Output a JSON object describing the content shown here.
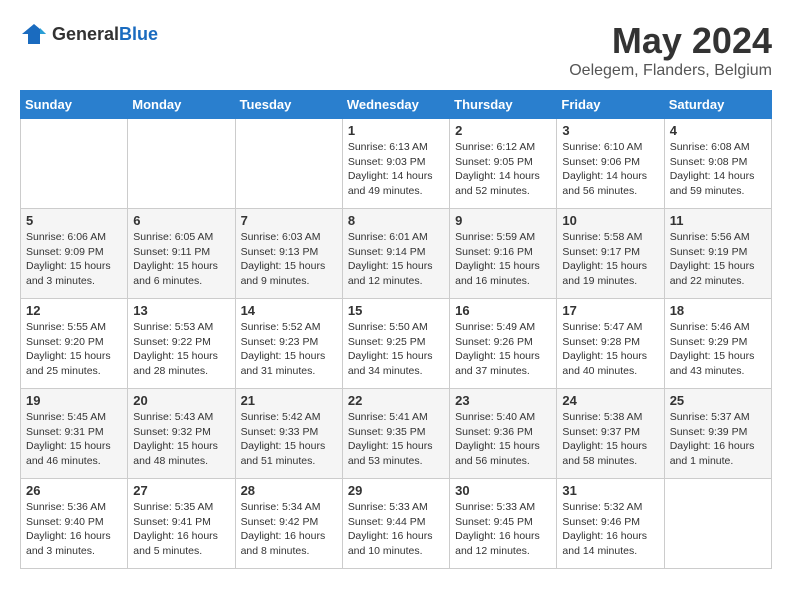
{
  "logo": {
    "text_general": "General",
    "text_blue": "Blue"
  },
  "title": {
    "month": "May 2024",
    "location": "Oelegem, Flanders, Belgium"
  },
  "days_of_week": [
    "Sunday",
    "Monday",
    "Tuesday",
    "Wednesday",
    "Thursday",
    "Friday",
    "Saturday"
  ],
  "weeks": [
    [
      {
        "day": "",
        "sunrise": "",
        "sunset": "",
        "daylight": ""
      },
      {
        "day": "",
        "sunrise": "",
        "sunset": "",
        "daylight": ""
      },
      {
        "day": "",
        "sunrise": "",
        "sunset": "",
        "daylight": ""
      },
      {
        "day": "1",
        "sunrise": "Sunrise: 6:13 AM",
        "sunset": "Sunset: 9:03 PM",
        "daylight": "Daylight: 14 hours and 49 minutes."
      },
      {
        "day": "2",
        "sunrise": "Sunrise: 6:12 AM",
        "sunset": "Sunset: 9:05 PM",
        "daylight": "Daylight: 14 hours and 52 minutes."
      },
      {
        "day": "3",
        "sunrise": "Sunrise: 6:10 AM",
        "sunset": "Sunset: 9:06 PM",
        "daylight": "Daylight: 14 hours and 56 minutes."
      },
      {
        "day": "4",
        "sunrise": "Sunrise: 6:08 AM",
        "sunset": "Sunset: 9:08 PM",
        "daylight": "Daylight: 14 hours and 59 minutes."
      }
    ],
    [
      {
        "day": "5",
        "sunrise": "Sunrise: 6:06 AM",
        "sunset": "Sunset: 9:09 PM",
        "daylight": "Daylight: 15 hours and 3 minutes."
      },
      {
        "day": "6",
        "sunrise": "Sunrise: 6:05 AM",
        "sunset": "Sunset: 9:11 PM",
        "daylight": "Daylight: 15 hours and 6 minutes."
      },
      {
        "day": "7",
        "sunrise": "Sunrise: 6:03 AM",
        "sunset": "Sunset: 9:13 PM",
        "daylight": "Daylight: 15 hours and 9 minutes."
      },
      {
        "day": "8",
        "sunrise": "Sunrise: 6:01 AM",
        "sunset": "Sunset: 9:14 PM",
        "daylight": "Daylight: 15 hours and 12 minutes."
      },
      {
        "day": "9",
        "sunrise": "Sunrise: 5:59 AM",
        "sunset": "Sunset: 9:16 PM",
        "daylight": "Daylight: 15 hours and 16 minutes."
      },
      {
        "day": "10",
        "sunrise": "Sunrise: 5:58 AM",
        "sunset": "Sunset: 9:17 PM",
        "daylight": "Daylight: 15 hours and 19 minutes."
      },
      {
        "day": "11",
        "sunrise": "Sunrise: 5:56 AM",
        "sunset": "Sunset: 9:19 PM",
        "daylight": "Daylight: 15 hours and 22 minutes."
      }
    ],
    [
      {
        "day": "12",
        "sunrise": "Sunrise: 5:55 AM",
        "sunset": "Sunset: 9:20 PM",
        "daylight": "Daylight: 15 hours and 25 minutes."
      },
      {
        "day": "13",
        "sunrise": "Sunrise: 5:53 AM",
        "sunset": "Sunset: 9:22 PM",
        "daylight": "Daylight: 15 hours and 28 minutes."
      },
      {
        "day": "14",
        "sunrise": "Sunrise: 5:52 AM",
        "sunset": "Sunset: 9:23 PM",
        "daylight": "Daylight: 15 hours and 31 minutes."
      },
      {
        "day": "15",
        "sunrise": "Sunrise: 5:50 AM",
        "sunset": "Sunset: 9:25 PM",
        "daylight": "Daylight: 15 hours and 34 minutes."
      },
      {
        "day": "16",
        "sunrise": "Sunrise: 5:49 AM",
        "sunset": "Sunset: 9:26 PM",
        "daylight": "Daylight: 15 hours and 37 minutes."
      },
      {
        "day": "17",
        "sunrise": "Sunrise: 5:47 AM",
        "sunset": "Sunset: 9:28 PM",
        "daylight": "Daylight: 15 hours and 40 minutes."
      },
      {
        "day": "18",
        "sunrise": "Sunrise: 5:46 AM",
        "sunset": "Sunset: 9:29 PM",
        "daylight": "Daylight: 15 hours and 43 minutes."
      }
    ],
    [
      {
        "day": "19",
        "sunrise": "Sunrise: 5:45 AM",
        "sunset": "Sunset: 9:31 PM",
        "daylight": "Daylight: 15 hours and 46 minutes."
      },
      {
        "day": "20",
        "sunrise": "Sunrise: 5:43 AM",
        "sunset": "Sunset: 9:32 PM",
        "daylight": "Daylight: 15 hours and 48 minutes."
      },
      {
        "day": "21",
        "sunrise": "Sunrise: 5:42 AM",
        "sunset": "Sunset: 9:33 PM",
        "daylight": "Daylight: 15 hours and 51 minutes."
      },
      {
        "day": "22",
        "sunrise": "Sunrise: 5:41 AM",
        "sunset": "Sunset: 9:35 PM",
        "daylight": "Daylight: 15 hours and 53 minutes."
      },
      {
        "day": "23",
        "sunrise": "Sunrise: 5:40 AM",
        "sunset": "Sunset: 9:36 PM",
        "daylight": "Daylight: 15 hours and 56 minutes."
      },
      {
        "day": "24",
        "sunrise": "Sunrise: 5:38 AM",
        "sunset": "Sunset: 9:37 PM",
        "daylight": "Daylight: 15 hours and 58 minutes."
      },
      {
        "day": "25",
        "sunrise": "Sunrise: 5:37 AM",
        "sunset": "Sunset: 9:39 PM",
        "daylight": "Daylight: 16 hours and 1 minute."
      }
    ],
    [
      {
        "day": "26",
        "sunrise": "Sunrise: 5:36 AM",
        "sunset": "Sunset: 9:40 PM",
        "daylight": "Daylight: 16 hours and 3 minutes."
      },
      {
        "day": "27",
        "sunrise": "Sunrise: 5:35 AM",
        "sunset": "Sunset: 9:41 PM",
        "daylight": "Daylight: 16 hours and 5 minutes."
      },
      {
        "day": "28",
        "sunrise": "Sunrise: 5:34 AM",
        "sunset": "Sunset: 9:42 PM",
        "daylight": "Daylight: 16 hours and 8 minutes."
      },
      {
        "day": "29",
        "sunrise": "Sunrise: 5:33 AM",
        "sunset": "Sunset: 9:44 PM",
        "daylight": "Daylight: 16 hours and 10 minutes."
      },
      {
        "day": "30",
        "sunrise": "Sunrise: 5:33 AM",
        "sunset": "Sunset: 9:45 PM",
        "daylight": "Daylight: 16 hours and 12 minutes."
      },
      {
        "day": "31",
        "sunrise": "Sunrise: 5:32 AM",
        "sunset": "Sunset: 9:46 PM",
        "daylight": "Daylight: 16 hours and 14 minutes."
      },
      {
        "day": "",
        "sunrise": "",
        "sunset": "",
        "daylight": ""
      }
    ]
  ]
}
